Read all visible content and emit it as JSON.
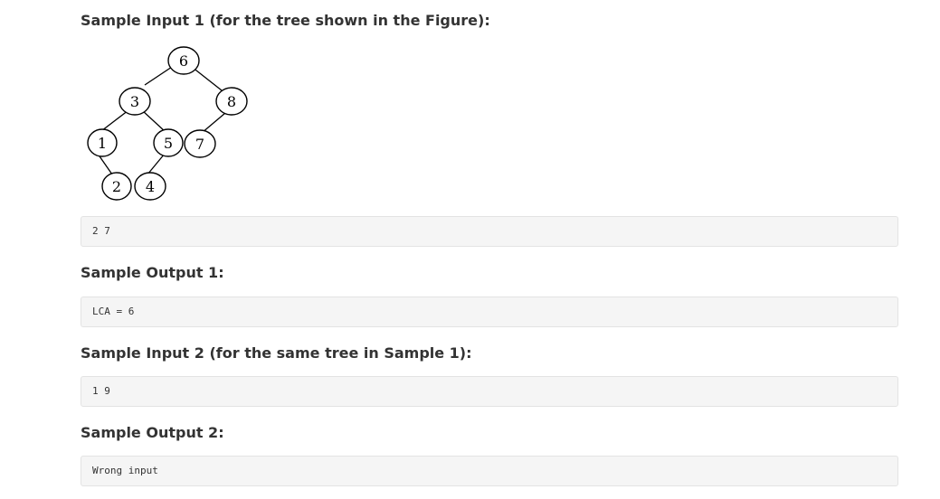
{
  "sample_input_1": {
    "heading": "Sample Input 1 (for the tree shown in the Figure):",
    "code": "2 7"
  },
  "figure": {
    "nodes": [
      "6",
      "3",
      "8",
      "1",
      "5",
      "7",
      "2",
      "4"
    ]
  },
  "sample_output_1": {
    "heading": "Sample Output 1:",
    "code": "LCA = 6"
  },
  "sample_input_2": {
    "heading": "Sample Input 2 (for the same tree in Sample 1):",
    "code": "1 9"
  },
  "sample_output_2": {
    "heading": "Sample Output 2:",
    "code": "Wrong input"
  }
}
